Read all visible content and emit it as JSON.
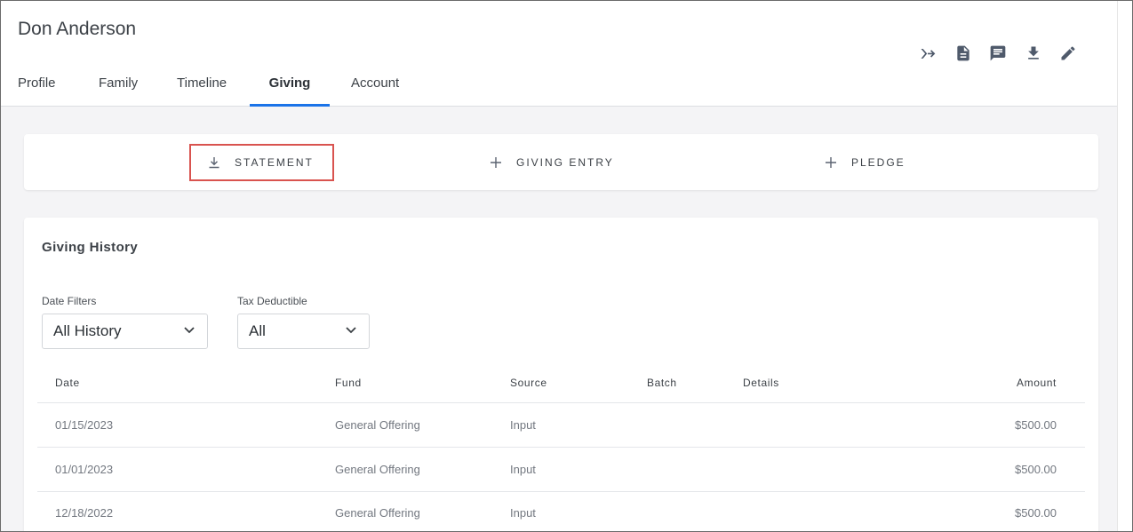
{
  "header": {
    "person_name": "Don Anderson",
    "tabs": [
      {
        "label": "Profile",
        "active": false
      },
      {
        "label": "Family",
        "active": false
      },
      {
        "label": "Timeline",
        "active": false
      },
      {
        "label": "Giving",
        "active": true
      },
      {
        "label": "Account",
        "active": false
      }
    ],
    "toolbar_icons": [
      "merge-icon",
      "document-icon",
      "comment-icon",
      "download-icon",
      "edit-icon"
    ],
    "active_tab_color": "#1a73e8"
  },
  "actions": {
    "statement_label": "STATEMENT",
    "giving_entry_label": "GIVING ENTRY",
    "pledge_label": "PLEDGE",
    "highlight_color": "#d9534f"
  },
  "history": {
    "title": "Giving History",
    "filters": {
      "date_label": "Date Filters",
      "date_value": "All History",
      "tax_label": "Tax Deductible",
      "tax_value": "All"
    },
    "columns": {
      "date": "Date",
      "fund": "Fund",
      "source": "Source",
      "batch": "Batch",
      "details": "Details",
      "amount": "Amount"
    },
    "rows": [
      {
        "date": "01/15/2023",
        "fund": "General Offering",
        "source": "Input",
        "batch": "",
        "details": "",
        "amount": "$500.00"
      },
      {
        "date": "01/01/2023",
        "fund": "General Offering",
        "source": "Input",
        "batch": "",
        "details": "",
        "amount": "$500.00"
      },
      {
        "date": "12/18/2022",
        "fund": "General Offering",
        "source": "Input",
        "batch": "",
        "details": "",
        "amount": "$500.00"
      }
    ]
  }
}
